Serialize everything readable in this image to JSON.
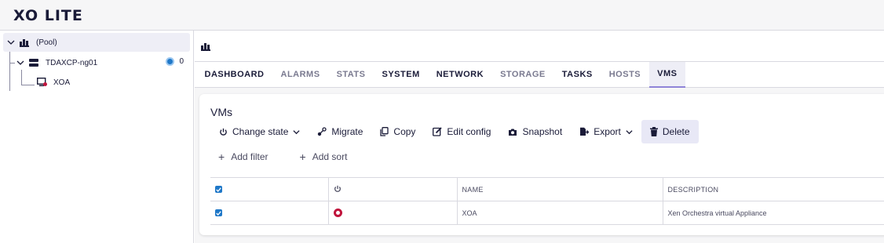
{
  "app": {
    "logo": "XO LITE"
  },
  "sidebar": {
    "pool": {
      "label": "(Pool)"
    },
    "host": {
      "label": "TDAXCP-ng01",
      "count": "0"
    },
    "vm": {
      "label": "XOA"
    }
  },
  "tabs": [
    {
      "label": "DASHBOARD",
      "active": false
    },
    {
      "label": "ALARMS",
      "active": false
    },
    {
      "label": "STATS",
      "active": false
    },
    {
      "label": "SYSTEM",
      "active": false
    },
    {
      "label": "NETWORK",
      "active": false
    },
    {
      "label": "STORAGE",
      "active": false
    },
    {
      "label": "TASKS",
      "active": false
    },
    {
      "label": "HOSTS",
      "active": false
    },
    {
      "label": "VMS",
      "active": true
    }
  ],
  "vms_panel": {
    "title": "VMs",
    "toolbar": {
      "change_state": "Change state",
      "migrate": "Migrate",
      "copy": "Copy",
      "edit_config": "Edit config",
      "snapshot": "Snapshot",
      "export": "Export",
      "delete": "Delete"
    },
    "add_filter": "Add filter",
    "add_sort": "Add sort",
    "columns": {
      "name": "NAME",
      "description": "DESCRIPTION"
    },
    "rows": [
      {
        "name": "XOA",
        "description": "Xen Orchestra virtual Appliance",
        "power_state": "halted",
        "selected": true
      }
    ]
  },
  "colors": {
    "accent": "#8f84d8",
    "checkbox": "#1f78c8",
    "halted": "#c0143c"
  }
}
